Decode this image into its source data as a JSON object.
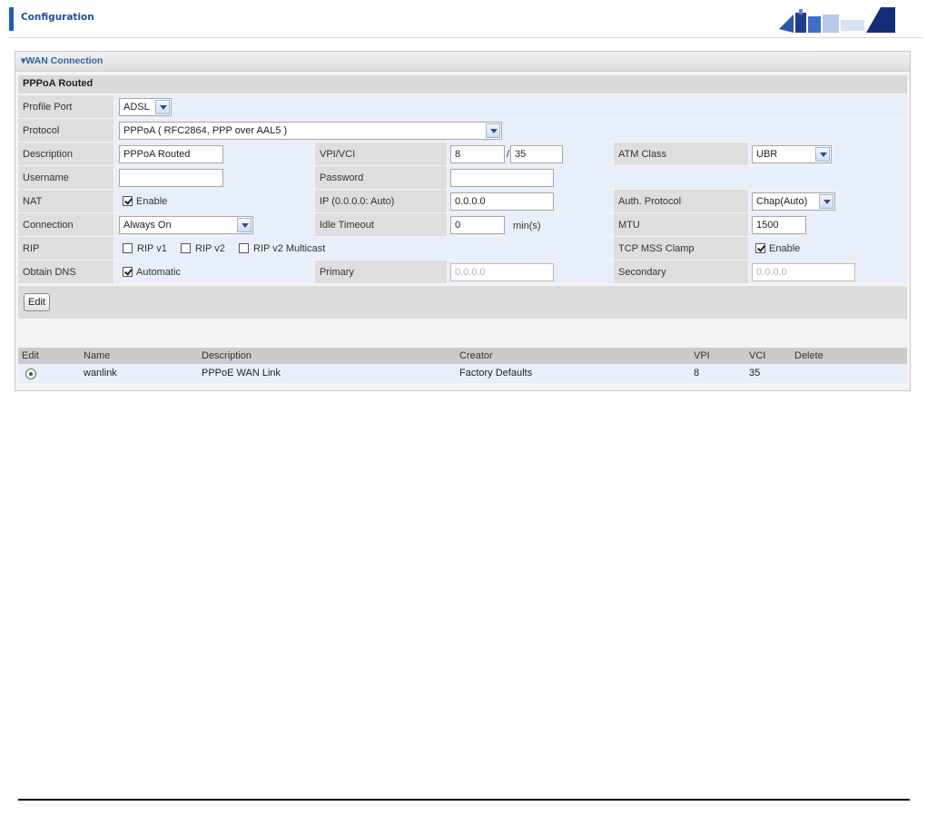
{
  "header": {
    "title": "Configuration",
    "accent_color": "#1d5fb4"
  },
  "panel": {
    "title": "WAN Connection",
    "section_title": "PPPoA Routed",
    "fields": {
      "profile_port": {
        "label": "Profile Port",
        "value": "ADSL"
      },
      "protocol": {
        "label": "Protocol",
        "value": "PPPoA ( RFC2864, PPP over AAL5 )"
      },
      "description": {
        "label": "Description",
        "value": "PPPoA Routed"
      },
      "vpi_vci": {
        "label": "VPI/VCI",
        "vpi": "8",
        "separator": "/",
        "vci": "35"
      },
      "atm_class": {
        "label": "ATM Class",
        "value": "UBR"
      },
      "username": {
        "label": "Username",
        "value": ""
      },
      "password": {
        "label": "Password",
        "value": ""
      },
      "nat": {
        "label": "NAT",
        "checkbox_label": "Enable",
        "checked": true
      },
      "ip": {
        "label": "IP (0.0.0.0: Auto)",
        "value": "0.0.0.0"
      },
      "auth_protocol": {
        "label": "Auth. Protocol",
        "value": "Chap(Auto)"
      },
      "connection": {
        "label": "Connection",
        "value": "Always On"
      },
      "idle_timeout": {
        "label": "Idle Timeout",
        "value": "0",
        "unit": "min(s)"
      },
      "mtu": {
        "label": "MTU",
        "value": "1500"
      },
      "rip": {
        "label": "RIP",
        "options": [
          {
            "label": "RIP v1",
            "checked": false
          },
          {
            "label": "RIP v2",
            "checked": false
          },
          {
            "label": "RIP v2 Multicast",
            "checked": false
          }
        ]
      },
      "tcp_mss_clamp": {
        "label": "TCP MSS Clamp",
        "checkbox_label": "Enable",
        "checked": true
      },
      "obtain_dns": {
        "label": "Obtain DNS",
        "checkbox_label": "Automatic",
        "checked": true
      },
      "primary": {
        "label": "Primary",
        "placeholder": "0.0.0.0"
      },
      "secondary": {
        "label": "Secondary",
        "placeholder": "0.0.0.0"
      }
    },
    "edit_button": "Edit",
    "table": {
      "columns": [
        "Edit",
        "Name",
        "Description",
        "Creator",
        "VPI",
        "VCI",
        "Delete"
      ],
      "rows": [
        {
          "name": "wanlink",
          "description": "PPPoE WAN Link",
          "creator": "Factory Defaults",
          "vpi": "8",
          "vci": "35",
          "selected": true
        }
      ]
    }
  }
}
